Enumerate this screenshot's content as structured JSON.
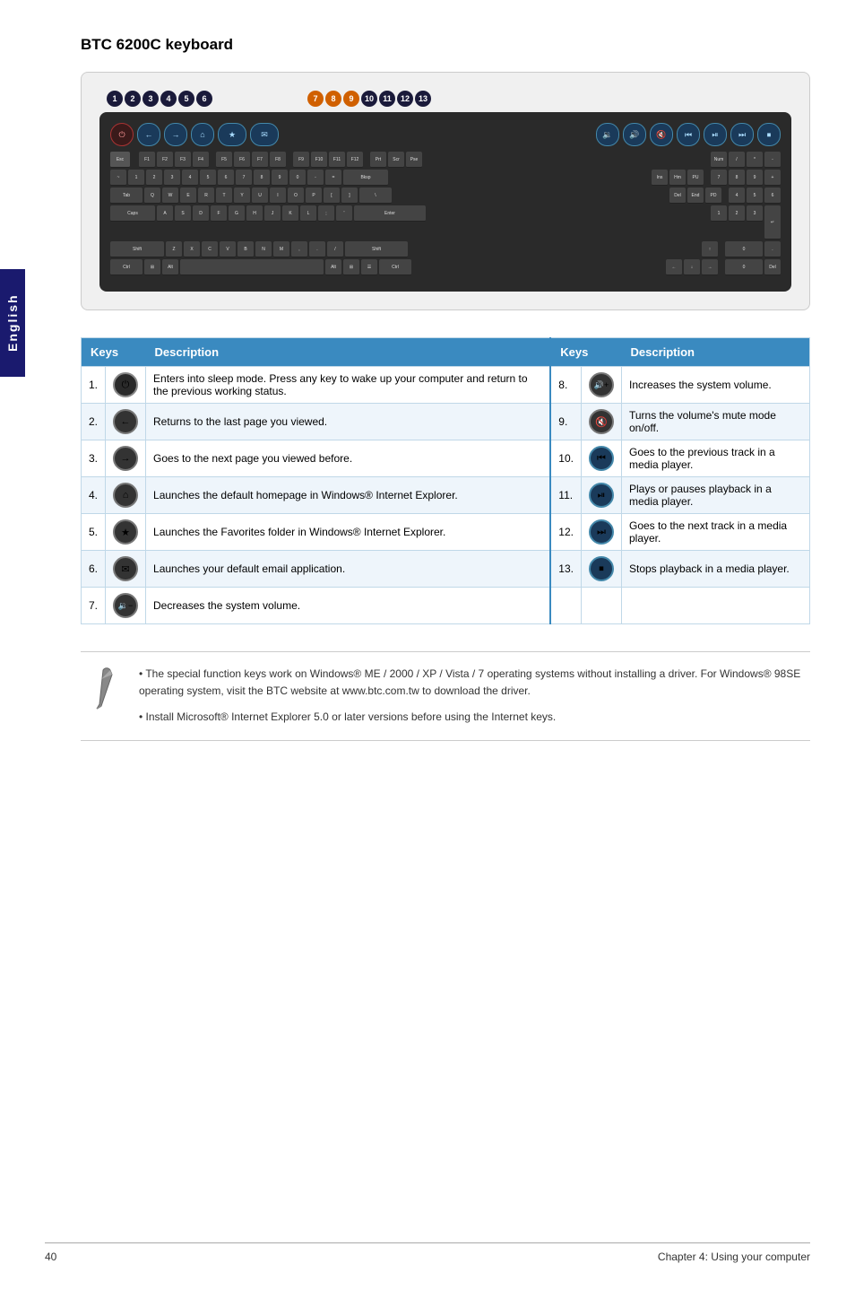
{
  "side_tab": "English",
  "page_title": "BTC 6200C keyboard",
  "left_numbers": [
    "1",
    "2",
    "3",
    "4",
    "5",
    "6"
  ],
  "right_numbers": [
    "7",
    "8",
    "9",
    "10",
    "11",
    "12",
    "13"
  ],
  "table": {
    "col1_header_keys": "Keys",
    "col1_header_desc": "Description",
    "col2_header_keys": "Keys",
    "col2_header_desc": "Description",
    "rows": [
      {
        "left_num": "1.",
        "left_icon": "⏻",
        "left_desc": "Enters into sleep mode. Press any key to wake up your computer and return to the previous working status.",
        "right_num": "8.",
        "right_icon": "🔊+",
        "right_desc": "Increases the system volume."
      },
      {
        "left_num": "2.",
        "left_icon": "←",
        "left_desc": "Returns to the last page you viewed.",
        "right_num": "9.",
        "right_icon": "🔇",
        "right_desc": "Turns the volume's mute mode on/off."
      },
      {
        "left_num": "3.",
        "left_icon": "→",
        "left_desc": "Goes to the next page you viewed before.",
        "right_num": "10.",
        "right_icon": "|◀◀",
        "right_desc": "Goes to the previous track in a media player."
      },
      {
        "left_num": "4.",
        "left_icon": "⌂",
        "left_desc": "Launches the default homepage in Windows® Internet Explorer.",
        "right_num": "11.",
        "right_icon": "▶/‖",
        "right_desc": "Plays or pauses playback in a media player."
      },
      {
        "left_num": "5.",
        "left_icon": "★",
        "left_desc": "Launches the Favorites folder in Windows® Internet Explorer.",
        "right_num": "12.",
        "right_icon": "▶▶|",
        "right_desc": "Goes to the next track in a media player."
      },
      {
        "left_num": "6.",
        "left_icon": "✉",
        "left_desc": "Launches your default email application.",
        "right_num": "13.",
        "right_icon": "■",
        "right_desc": "Stops playback in a media player."
      },
      {
        "left_num": "7.",
        "left_icon": "🔉-",
        "left_desc": "Decreases the system volume.",
        "right_num": "",
        "right_icon": "",
        "right_desc": ""
      }
    ]
  },
  "notes": [
    "The special function keys work on Windows® ME / 2000 / XP / Vista / 7 operating systems without installing a driver. For Windows® 98SE operating system, visit the BTC website at www.btc.com.tw to download the driver.",
    "Install Microsoft® Internet Explorer 5.0 or later versions before using the Internet keys."
  ],
  "footer": {
    "page_num": "40",
    "chapter": "Chapter 4: Using your computer"
  }
}
